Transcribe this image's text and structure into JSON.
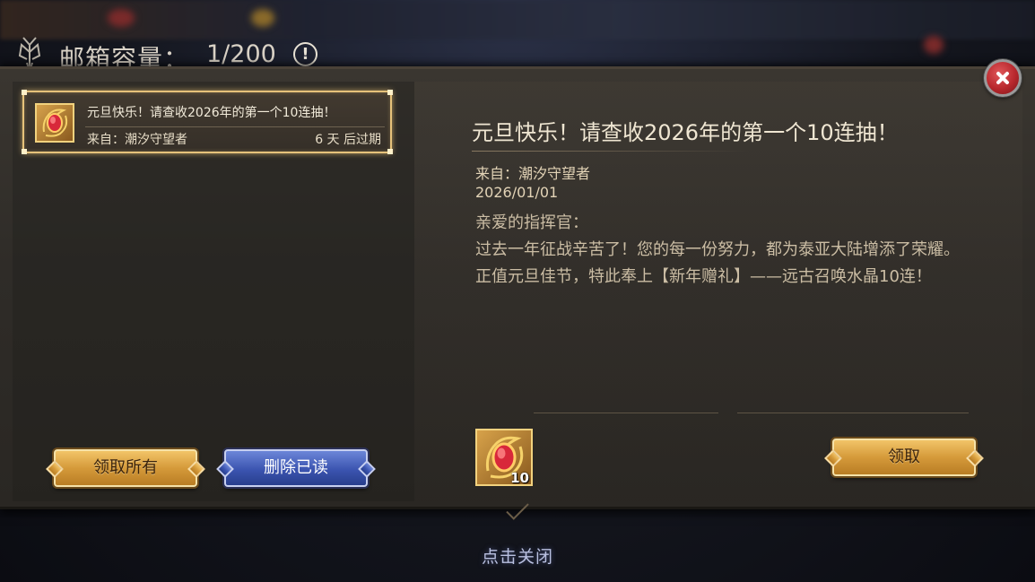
{
  "header": {
    "title": "邮箱容量：",
    "count": "1/200",
    "info_symbol": "!"
  },
  "mail_list": [
    {
      "subject": "元旦快乐！请查收2026年的第一个10连抽！",
      "sender": "来自：潮汐守望者",
      "expire": "6 天 后过期",
      "icon": "red-gem-icon",
      "selected": true
    }
  ],
  "buttons": {
    "claim_all": "领取所有",
    "delete_read": "删除已读",
    "claim": "领取"
  },
  "detail": {
    "title": "元旦快乐！请查收2026年的第一个10连抽！",
    "sender": "来自：潮汐守望者",
    "date": "2026/01/01",
    "greeting": "亲爱的指挥官：",
    "paragraph1": "过去一年征战辛苦了！您的每一份努力，都为泰亚大陆增添了荣耀。",
    "paragraph2": "正值元旦佳节，特此奉上【新年赠礼】——远古召唤水晶10连！"
  },
  "reward": {
    "icon": "red-gem-icon",
    "quantity": "10"
  },
  "footer": {
    "close_hint": "点击关闭"
  },
  "colors": {
    "gold_accent": "#e6c27a",
    "close_red": "#b8282d",
    "blue_button": "#3b54b0"
  }
}
